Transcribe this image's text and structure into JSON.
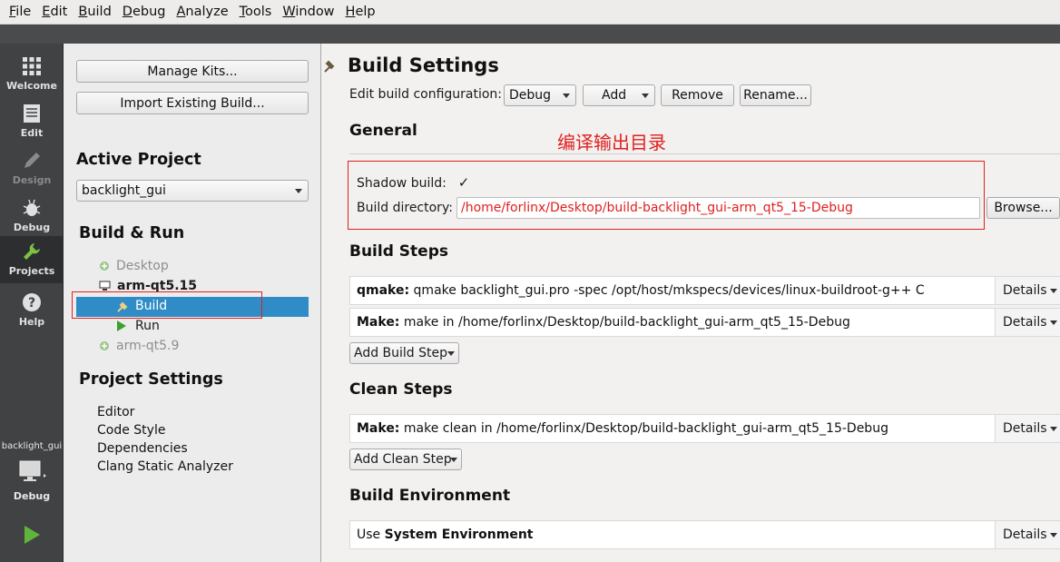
{
  "menu": [
    "File",
    "Edit",
    "Build",
    "Debug",
    "Analyze",
    "Tools",
    "Window",
    "Help"
  ],
  "modes": [
    {
      "label": "Welcome",
      "icon": "grid-icon",
      "state": "normal"
    },
    {
      "label": "Edit",
      "icon": "document-icon",
      "state": "normal"
    },
    {
      "label": "Design",
      "icon": "pencil-icon",
      "state": "disabled"
    },
    {
      "label": "Debug",
      "icon": "bug-icon",
      "state": "normal"
    },
    {
      "label": "Projects",
      "icon": "wrench-icon",
      "state": "active"
    },
    {
      "label": "Help",
      "icon": "question-icon",
      "state": "normal"
    }
  ],
  "target": {
    "project": "backlight_gui",
    "mode": "Debug",
    "icon": "monitor-icon",
    "run_icon": "play-icon"
  },
  "sidebar": {
    "manage_kits": "Manage Kits...",
    "import_build": "Import Existing Build...",
    "active_project_heading": "Active Project",
    "active_project": "backlight_gui",
    "build_run_heading": "Build & Run",
    "kits": [
      {
        "name": "Desktop",
        "state": "disabled"
      },
      {
        "name": "arm-qt5.15",
        "state": "active"
      },
      {
        "name": "arm-qt5.9",
        "state": "disabled"
      }
    ],
    "kit_children": [
      {
        "label": "Build",
        "selected": true
      },
      {
        "label": "Run",
        "selected": false
      }
    ],
    "project_settings_heading": "Project Settings",
    "project_settings": [
      "Editor",
      "Code Style",
      "Dependencies",
      "Clang Static Analyzer"
    ]
  },
  "main": {
    "title": "Build Settings",
    "edit_config_label": "Edit build configuration:",
    "config_value": "Debug",
    "add_label": "Add",
    "remove_label": "Remove",
    "rename_label": "Rename...",
    "general_heading": "General",
    "annotation": "编译输出目录",
    "shadow_build_label": "Shadow build:",
    "shadow_build_checked": "✓",
    "build_dir_label": "Build directory:",
    "build_dir_value": "/home/forlinx/Desktop/build-backlight_gui-arm_qt5_15-Debug",
    "browse_label": "Browse...",
    "build_steps_heading": "Build Steps",
    "build_steps": [
      {
        "key": "qmake:",
        "text": " qmake backlight_gui.pro -spec /opt/host/mkspecs/devices/linux-buildroot-g++ C"
      },
      {
        "key": "Make:",
        "text": " make in /home/forlinx/Desktop/build-backlight_gui-arm_qt5_15-Debug"
      }
    ],
    "add_build_step": "Add Build Step",
    "clean_steps_heading": "Clean Steps",
    "clean_steps": [
      {
        "key": "Make:",
        "text": " make clean in /home/forlinx/Desktop/build-backlight_gui-arm_qt5_15-Debug"
      }
    ],
    "add_clean_step": "Add Clean Step",
    "build_env_heading": "Build Environment",
    "env_prefix": "Use ",
    "env_value": "System Environment",
    "details_label": "Details"
  },
  "colors": {
    "annotation_red": "#e0201e",
    "selection_blue": "#308cc6",
    "dark_bar": "#404244"
  }
}
